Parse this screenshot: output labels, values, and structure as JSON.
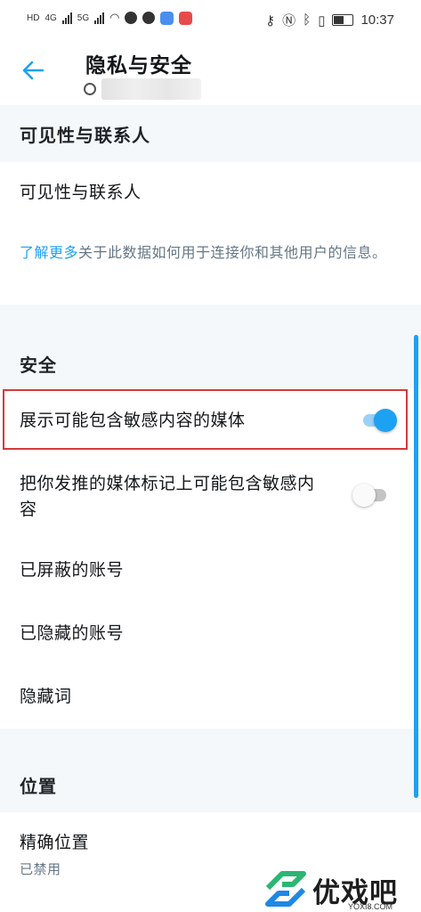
{
  "status_bar": {
    "left_labels": [
      "HD",
      "4G",
      "5G"
    ],
    "time": "10:37"
  },
  "header": {
    "title": "隐私与安全"
  },
  "sections": {
    "visibility": {
      "heading": "可见性与联系人",
      "row_label": "可见性与联系人",
      "note_link": "了解更多",
      "note_text": "关于此数据如何用于连接你和其他用户的信息。"
    },
    "security": {
      "heading": "安全",
      "sensitive_media": {
        "label": "展示可能包含敏感内容的媒体",
        "enabled": true
      },
      "mark_media": {
        "label": "把你发推的媒体标记上可能包含敏感内容",
        "enabled": false
      },
      "blocked_accounts": "已屏蔽的账号",
      "muted_accounts": "已隐藏的账号",
      "muted_words": "隐藏词"
    },
    "location": {
      "heading": "位置",
      "precise_location": "精确位置",
      "precise_location_status": "已禁用"
    }
  },
  "watermark": {
    "brand": "优戏吧",
    "url": "YOXI8.COM"
  },
  "colors": {
    "accent": "#1da1f2",
    "highlight_border": "#d33a3a",
    "section_bg": "#f5f8fa",
    "secondary_text": "#657786"
  }
}
